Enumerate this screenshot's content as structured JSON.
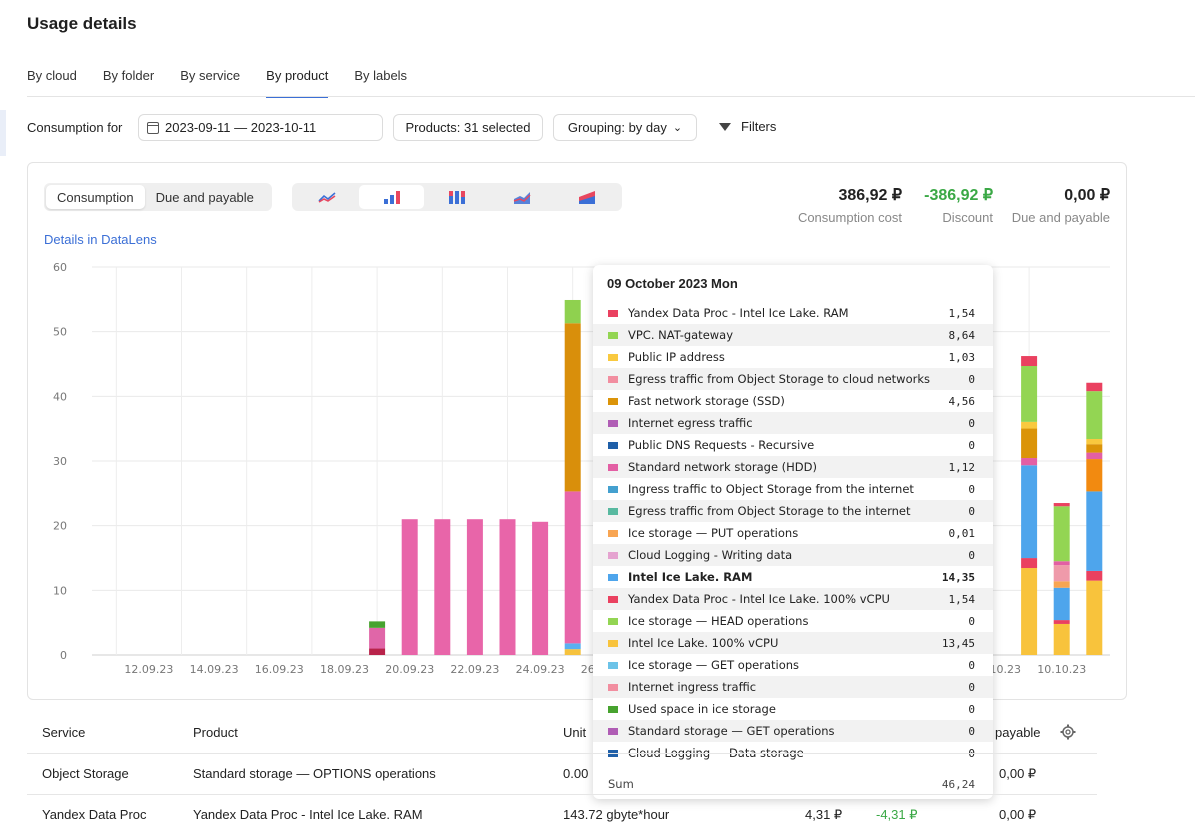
{
  "page": {
    "title": "Usage details"
  },
  "tabs": [
    "By cloud",
    "By folder",
    "By service",
    "By product",
    "By labels"
  ],
  "active_tab": 3,
  "toolbar": {
    "consumption_label": "Consumption for",
    "date_range": "2023-09-11 — 2023-10-11",
    "products": "Products: 31 selected",
    "grouping": "Grouping:  by day",
    "filters": "Filters"
  },
  "view_toggle": {
    "options": [
      "Consumption",
      "Due and payable"
    ],
    "active": 0
  },
  "chart_types": [
    "line-chart-icon",
    "bar-chart-icon",
    "stacked-bar-icon",
    "area-chart-icon",
    "stacked-area-icon"
  ],
  "totals": {
    "consumption_cost": {
      "value": "386,92 ₽",
      "label": "Consumption cost"
    },
    "discount": {
      "value": "-386,92 ₽",
      "label": "Discount"
    },
    "due": {
      "value": "0,00 ₽",
      "label": "Due and payable"
    }
  },
  "datalens_link": "Details in DataLens",
  "colors": {
    "accent": "#3b6fd6",
    "discount": "#3aa845"
  },
  "chart_data": {
    "type": "bar",
    "stacked": true,
    "ylim": [
      0,
      60
    ],
    "yticks": [
      0,
      10,
      20,
      30,
      40,
      50,
      60
    ],
    "x_tick_labels": [
      "12.09.23",
      "14.09.23",
      "16.09.23",
      "18.09.23",
      "20.09.23",
      "22.09.23",
      "24.09.23",
      "26.09.23",
      "28.09.23",
      "30.09.23",
      "02.10.23",
      "04.10.23",
      "06.10.23",
      "08.10.23",
      "10.10.23"
    ],
    "grid": true,
    "bars": [
      {
        "date": "19.09.23",
        "segments": [
          {
            "color": "#b8234a",
            "value": 1.0
          },
          {
            "color": "#e066a8",
            "value": 3.2
          },
          {
            "color": "#47a32f",
            "value": 1.0
          }
        ]
      },
      {
        "date": "20.09.23",
        "segments": [
          {
            "color": "#e865a9",
            "value": 21.0
          }
        ]
      },
      {
        "date": "21.09.23",
        "segments": [
          {
            "color": "#e865a9",
            "value": 21.0
          }
        ]
      },
      {
        "date": "22.09.23",
        "segments": [
          {
            "color": "#e865a9",
            "value": 21.0
          }
        ]
      },
      {
        "date": "23.09.23",
        "segments": [
          {
            "color": "#e865a9",
            "value": 21.0
          }
        ]
      },
      {
        "date": "24.09.23",
        "segments": [
          {
            "color": "#e865a9",
            "value": 20.6
          }
        ]
      },
      {
        "date": "25.09.23",
        "segments": [
          {
            "color": "#f6c23e",
            "value": 0.9
          },
          {
            "color": "#5ab0f0",
            "value": 0.9
          },
          {
            "color": "#e865a9",
            "value": 23.5
          },
          {
            "color": "#d98f0b",
            "value": 26.0
          },
          {
            "color": "#8fd14f",
            "value": 3.6
          }
        ]
      },
      {
        "date": "09.10.23",
        "segments": [
          {
            "color": "#f8c33c",
            "value": 13.45
          },
          {
            "color": "#ea4160",
            "value": 1.54
          },
          {
            "color": "#4ea5ec",
            "value": 14.35
          },
          {
            "color": "#e35fa4",
            "value": 1.12
          },
          {
            "color": "#db9409",
            "value": 4.56
          },
          {
            "color": "#f9c93f",
            "value": 1.03
          },
          {
            "color": "#93d553",
            "value": 8.64
          },
          {
            "color": "#ea4160",
            "value": 1.54
          }
        ]
      },
      {
        "date": "10.10.23",
        "segments": [
          {
            "color": "#f8c33c",
            "value": 4.8
          },
          {
            "color": "#ea4160",
            "value": 0.6
          },
          {
            "color": "#4ea5ec",
            "value": 5.0
          },
          {
            "color": "#f8a552",
            "value": 1.0
          },
          {
            "color": "#ef9aaa",
            "value": 2.5
          },
          {
            "color": "#e35fa4",
            "value": 0.6
          },
          {
            "color": "#93d553",
            "value": 8.5
          },
          {
            "color": "#ea4160",
            "value": 0.5
          }
        ]
      },
      {
        "date": "11.10.23",
        "segments": [
          {
            "color": "#f8c33c",
            "value": 11.5
          },
          {
            "color": "#ea4160",
            "value": 1.5
          },
          {
            "color": "#4ea5ec",
            "value": 12.3
          },
          {
            "color": "#f28a10",
            "value": 5.0
          },
          {
            "color": "#e35fa4",
            "value": 1.0
          },
          {
            "color": "#db9409",
            "value": 1.3
          },
          {
            "color": "#f9c93f",
            "value": 0.8
          },
          {
            "color": "#93d553",
            "value": 7.4
          },
          {
            "color": "#ea4160",
            "value": 1.3
          }
        ]
      }
    ]
  },
  "tooltip": {
    "title": "09 October 2023 Mon",
    "rows": [
      {
        "name": "Yandex Data Proc - Intel Ice Lake. RAM",
        "value": "1,54",
        "color": "#ea4160"
      },
      {
        "name": "VPC. NAT-gateway",
        "value": "8,64",
        "color": "#93d553"
      },
      {
        "name": "Public IP address",
        "value": "1,03",
        "color": "#f9c93f"
      },
      {
        "name": "Egress traffic from Object Storage to cloud networks",
        "value": "0",
        "color": "#f28ea0"
      },
      {
        "name": "Fast network storage (SSD)",
        "value": "4,56",
        "color": "#db9409"
      },
      {
        "name": "Internet egress traffic",
        "value": "0",
        "color": "#b05db5"
      },
      {
        "name": "Public DNS Requests - Recursive",
        "value": "0",
        "color": "#1f5fa8"
      },
      {
        "name": "Standard network storage (HDD)",
        "value": "1,12",
        "color": "#e35fa4"
      },
      {
        "name": "Ingress traffic to Object Storage from the internet",
        "value": "0",
        "color": "#44a0cf"
      },
      {
        "name": "Egress traffic from Object Storage to the internet",
        "value": "0",
        "color": "#58b9a0"
      },
      {
        "name": "Ice storage — PUT operations",
        "value": "0,01",
        "color": "#f8a552"
      },
      {
        "name": "Cloud Logging - Writing data",
        "value": "0",
        "color": "#e5a3d0"
      },
      {
        "name": "Intel Ice Lake. RAM",
        "value": "14,35",
        "color": "#4ea5ec",
        "highlight": true
      },
      {
        "name": "Yandex Data Proc - Intel Ice Lake. 100% vCPU",
        "value": "1,54",
        "color": "#ea4160"
      },
      {
        "name": "Ice storage — HEAD operations",
        "value": "0",
        "color": "#93d553"
      },
      {
        "name": "Intel Ice Lake. 100% vCPU",
        "value": "13,45",
        "color": "#f8c33c"
      },
      {
        "name": "Ice storage — GET operations",
        "value": "0",
        "color": "#6cc3e8"
      },
      {
        "name": "Internet ingress traffic",
        "value": "0",
        "color": "#f28ea0"
      },
      {
        "name": "Used space in ice storage",
        "value": "0",
        "color": "#47a32f"
      },
      {
        "name": "Standard storage — GET operations",
        "value": "0",
        "color": "#b05db5"
      },
      {
        "name": "Cloud Logging — Data storage",
        "value": "0",
        "color": "#1f5fa8"
      }
    ],
    "sum_label": "Sum",
    "sum_value": "46,24"
  },
  "table": {
    "headers": {
      "service": "Service",
      "product": "Product",
      "unit": "Unit",
      "payable": "payable"
    },
    "rows": [
      {
        "service": "Object Storage",
        "product": "Standard storage — OPTIONS operations",
        "unit": "0.00",
        "cost": "",
        "discount": "",
        "due": "0,00 ₽"
      },
      {
        "service": "Yandex Data Proc",
        "product": "Yandex Data Proc - Intel Ice Lake. RAM",
        "unit": "143.72 gbyte*hour",
        "cost": "4,31 ₽",
        "discount": "-4,31 ₽",
        "due": "0,00 ₽"
      }
    ]
  }
}
